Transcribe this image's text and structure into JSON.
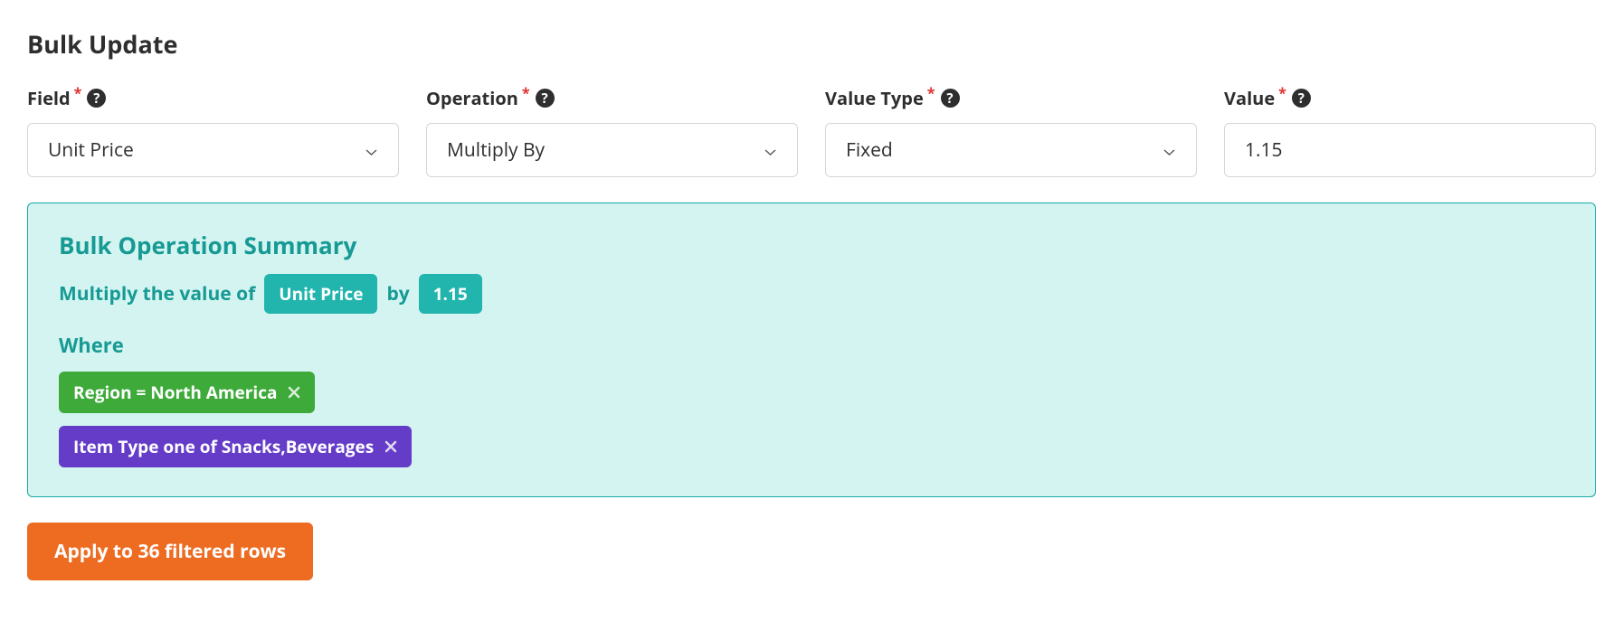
{
  "title": "Bulk Update",
  "fields": {
    "field": {
      "label": "Field",
      "value": "Unit Price"
    },
    "operation": {
      "label": "Operation",
      "value": "Multiply By"
    },
    "valueType": {
      "label": "Value Type",
      "value": "Fixed"
    },
    "value": {
      "label": "Value",
      "value": "1.15"
    }
  },
  "summary": {
    "title": "Bulk Operation Summary",
    "prefix": "Multiply the value of",
    "fieldPill": "Unit Price",
    "mid": "by",
    "valuePill": "1.15",
    "whereLabel": "Where",
    "filters": [
      {
        "text": "Region = North America",
        "color": "green"
      },
      {
        "text": "Item Type one of Snacks,Beverages",
        "color": "purple"
      }
    ]
  },
  "applyButton": "Apply to 36 filtered rows",
  "helpGlyph": "?"
}
